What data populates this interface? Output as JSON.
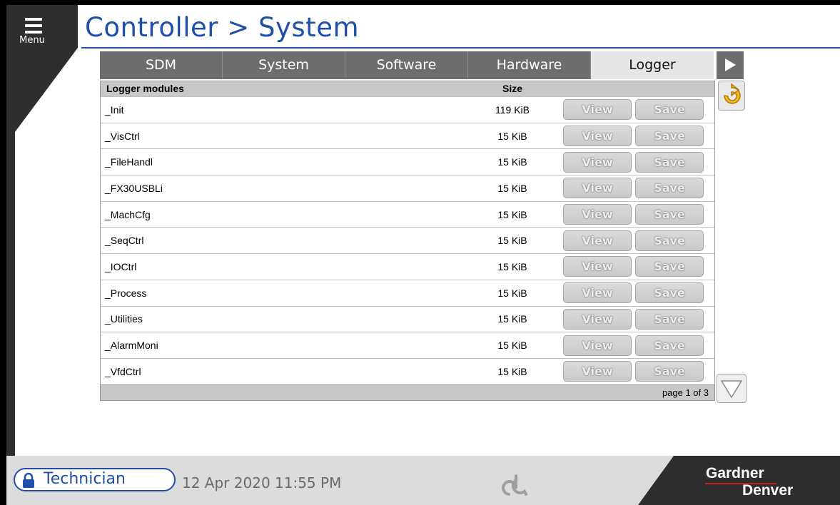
{
  "menu": {
    "label": "Menu"
  },
  "title": "Controller > System",
  "tabs": [
    {
      "label": "SDM",
      "active": false
    },
    {
      "label": "System",
      "active": false
    },
    {
      "label": "Software",
      "active": false
    },
    {
      "label": "Hardware",
      "active": false
    },
    {
      "label": "Logger",
      "active": true
    }
  ],
  "table": {
    "headers": {
      "name": "Logger modules",
      "size": "Size"
    },
    "view_label": "View",
    "save_label": "Save",
    "rows": [
      {
        "name": "_Init",
        "size": "119 KiB"
      },
      {
        "name": "_VisCtrl",
        "size": "15 KiB"
      },
      {
        "name": "_FileHandl",
        "size": "15 KiB"
      },
      {
        "name": "_FX30USBLi",
        "size": "15 KiB"
      },
      {
        "name": "_MachCfg",
        "size": "15 KiB"
      },
      {
        "name": "_SeqCtrl",
        "size": "15 KiB"
      },
      {
        "name": "_IOCtrl",
        "size": "15 KiB"
      },
      {
        "name": "_Process",
        "size": "15 KiB"
      },
      {
        "name": "_Utilities",
        "size": "15 KiB"
      },
      {
        "name": "_AlarmMoni",
        "size": "15 KiB"
      },
      {
        "name": "_VfdCtrl",
        "size": "15 KiB"
      }
    ],
    "pagination": "page 1 of 3"
  },
  "footer": {
    "user": "Technician",
    "datetime": "12 Apr 2020  11:55 PM",
    "brand_line1": "Gardner",
    "brand_line2": "Denver"
  },
  "colors": {
    "accent": "#1f4fa6",
    "tab_bg": "#6d6d6d",
    "brand_red": "#c5211f"
  },
  "icons": {
    "menu": "hamburger-icon",
    "next_tab": "triangle-right-icon",
    "refresh": "refresh-arrow-icon",
    "scroll_down": "triangle-down-icon",
    "lock": "lock-icon",
    "footer_logo": "swirl-logo-icon"
  }
}
